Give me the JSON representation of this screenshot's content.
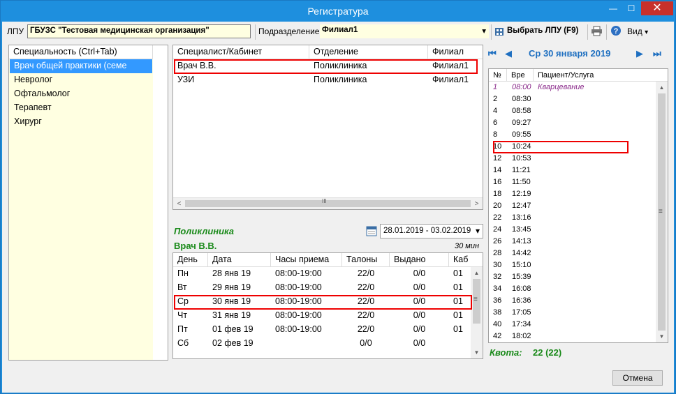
{
  "window": {
    "title": "Регистратура",
    "minimize_glyph": "—",
    "maximize_glyph": "☐",
    "close_glyph": "✕"
  },
  "toolbar": {
    "lpu_label": "ЛПУ",
    "lpu_value": "ГБУЗС \"Тестовая медицинская организация\"",
    "division_label": "Подразделение",
    "division_value": "Филиал1",
    "choose_lpu_label": "Выбрать ЛПУ (F9)",
    "view_label": "Вид",
    "dropdown_glyph": "▾"
  },
  "specialties": {
    "header": "Специальность (Ctrl+Tab)",
    "items": [
      "Врач общей практики (семе",
      "Невролог",
      "Офтальмолог",
      "Терапевт",
      "Хирург"
    ],
    "selected_index": 0
  },
  "specialists": {
    "columns": [
      "Специалист/Кабинет",
      "Отделение",
      "Филиал"
    ],
    "rows": [
      [
        "Врач В.В.",
        "Поликлиника",
        "Филиал1"
      ],
      [
        "УЗИ",
        "Поликлиника",
        "Филиал1"
      ]
    ],
    "scroll_left": "<",
    "scroll_right": ">",
    "scroll_grip": "III"
  },
  "schedule": {
    "department": "Поликлиника",
    "doctor": "Врач В.В.",
    "slot_length": "30 мин",
    "date_range": "28.01.2019 - 03.02.2019",
    "columns": [
      "День",
      "Дата",
      "Часы приема",
      "Талоны",
      "Выдано",
      "Каб"
    ],
    "rows": [
      [
        "Пн",
        "28 янв 19",
        "08:00-19:00",
        "22/0",
        "0/0",
        "01"
      ],
      [
        "Вт",
        "29 янв 19",
        "08:00-19:00",
        "22/0",
        "0/0",
        "01"
      ],
      [
        "Ср",
        "30 янв 19",
        "08:00-19:00",
        "22/0",
        "0/0",
        "01"
      ],
      [
        "Чт",
        "31 янв 19",
        "08:00-19:00",
        "22/0",
        "0/0",
        "01"
      ],
      [
        "Пт",
        "01 фев 19",
        "08:00-19:00",
        "22/0",
        "0/0",
        "01"
      ],
      [
        "Сб",
        "02 фев 19",
        "",
        "0/0",
        "0/0",
        ""
      ]
    ],
    "scroll_grip": "≡"
  },
  "day_view": {
    "date_title": "Ср 30 января 2019",
    "nav_first": "⏮",
    "nav_prev": "◀",
    "nav_next": "▶",
    "nav_last": "⏭",
    "columns": [
      "№",
      "Вре",
      "Пациент/Услуга"
    ],
    "slots": [
      [
        "1",
        "08:00",
        "Кварцевание"
      ],
      [
        "2",
        "08:30",
        ""
      ],
      [
        "4",
        "08:58",
        ""
      ],
      [
        "6",
        "09:27",
        ""
      ],
      [
        "8",
        "09:55",
        ""
      ],
      [
        "10",
        "10:24",
        ""
      ],
      [
        "12",
        "10:53",
        ""
      ],
      [
        "14",
        "11:21",
        ""
      ],
      [
        "16",
        "11:50",
        ""
      ],
      [
        "18",
        "12:19",
        ""
      ],
      [
        "20",
        "12:47",
        ""
      ],
      [
        "22",
        "13:16",
        ""
      ],
      [
        "24",
        "13:45",
        ""
      ],
      [
        "26",
        "14:13",
        ""
      ],
      [
        "28",
        "14:42",
        ""
      ],
      [
        "30",
        "15:10",
        ""
      ],
      [
        "32",
        "15:39",
        ""
      ],
      [
        "34",
        "16:08",
        ""
      ],
      [
        "36",
        "16:36",
        ""
      ],
      [
        "38",
        "17:05",
        ""
      ],
      [
        "40",
        "17:34",
        ""
      ],
      [
        "42",
        "18:02",
        ""
      ]
    ],
    "scroll_grip": "≡",
    "quota_label": "Квота:",
    "quota_value": "22 (22)"
  },
  "footer": {
    "cancel_label": "Отмена"
  },
  "colors": {
    "titlebar": "#1e8fde",
    "selection": "#3399ff",
    "highlight_box": "#e00000",
    "green_text": "#1a8a1a",
    "reserved_text": "#8a2a8a",
    "yellow_field": "#ffffe1"
  }
}
